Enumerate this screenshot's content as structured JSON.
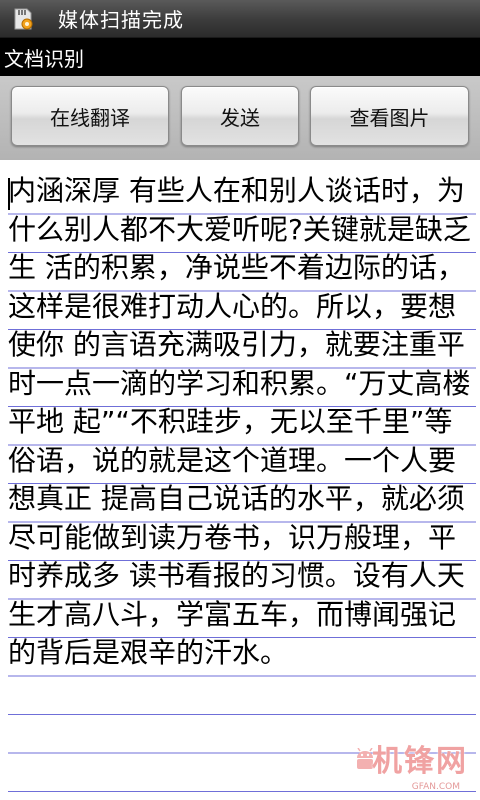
{
  "status_bar": {
    "icon": "sd-card-scan-icon",
    "notification_text": "媒体扫描完成"
  },
  "title_bar": {
    "title": "文档识别"
  },
  "toolbar": {
    "translate_label": "在线翻译",
    "send_label": "发送",
    "view_image_label": "查看图片"
  },
  "document": {
    "text": "内涵深厚 有些人在和别人谈话时，为什么别人都不大爱听呢?关键就是缺乏生 活的积累，净说些不着边际的话，这样是很难打动人心的。所以，要想使你 的言语充满吸引力，就要注重平时一点一滴的学习和积累。“万丈高楼平地 起”“不积跬步，无以至千里”等俗语，说的就是这个道理。一个人要想真正 提高自己说话的水平，就必须尽可能做到读万卷书，识万般理，平时养成多 读书看报的习惯。设有人天生才高八斗，学富五车，而博闻强记的背后是艰辛的汗水。",
    "line_color": "#6f6fd8"
  },
  "watermark": {
    "text": "机锋网",
    "sub_text": "GFAN.COM",
    "icon": "android-robot-icon",
    "color": "#f0a2a2"
  }
}
